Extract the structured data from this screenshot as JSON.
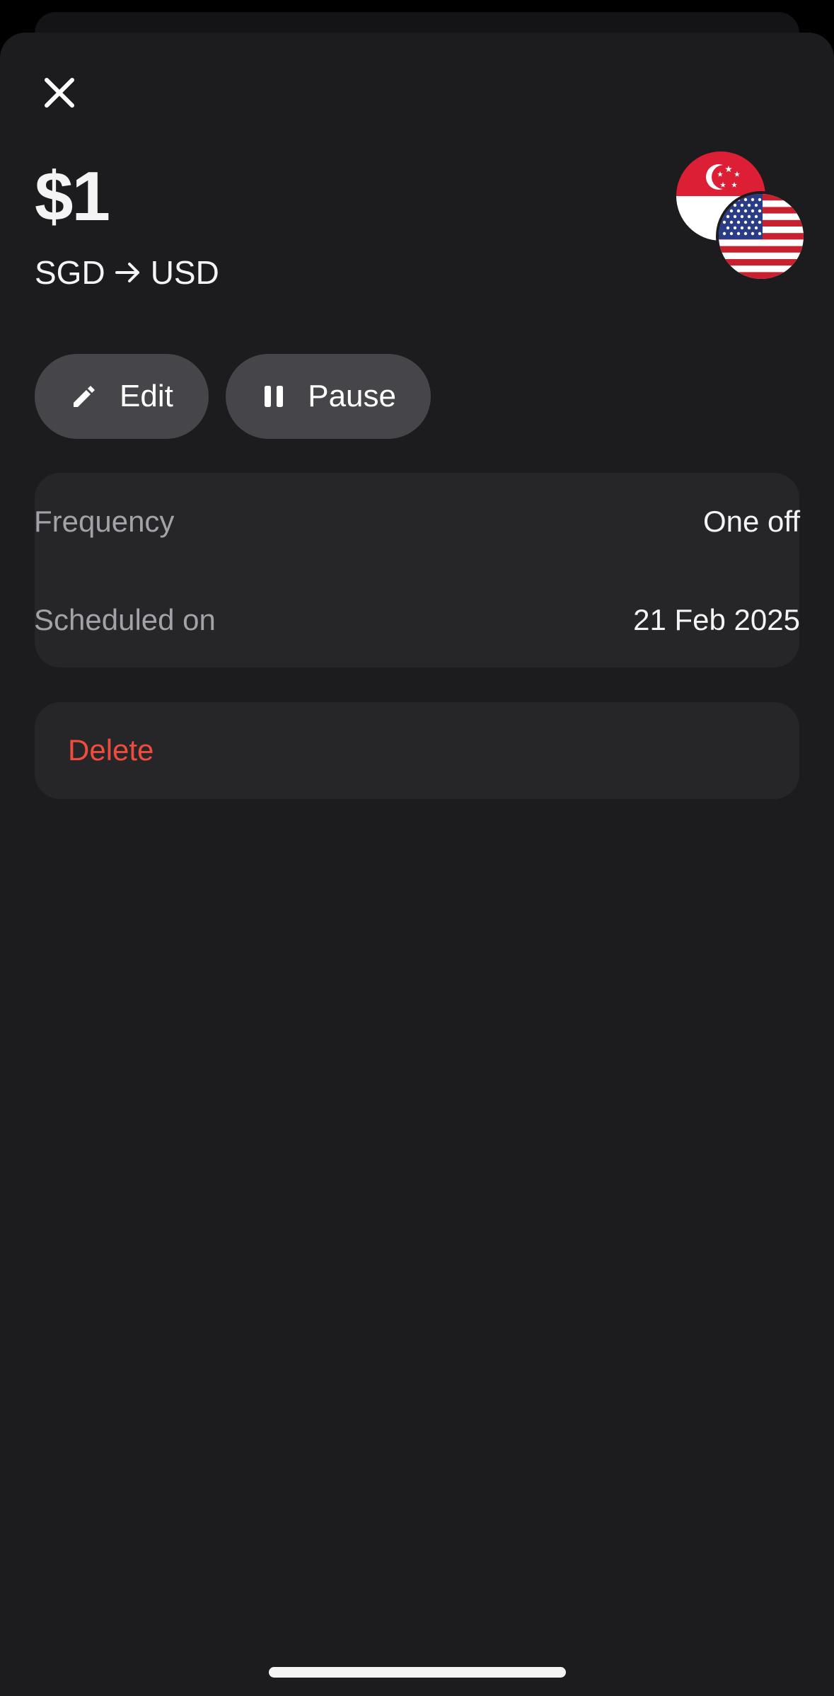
{
  "header": {
    "amount": "$1",
    "pair_from": "SGD",
    "pair_to": "USD"
  },
  "icons": {
    "close": "close-icon",
    "arrow": "arrow-right-icon",
    "edit": "pencil-icon",
    "pause": "pause-icon",
    "flag_from": "singapore-flag-icon",
    "flag_to": "usa-flag-icon"
  },
  "actions": {
    "edit_label": "Edit",
    "pause_label": "Pause"
  },
  "details": {
    "frequency_label": "Frequency",
    "frequency_value": "One off",
    "scheduled_label": "Scheduled on",
    "scheduled_value": "21 Feb 2025"
  },
  "danger": {
    "delete_label": "Delete"
  },
  "colors": {
    "background": "#1c1c1f",
    "card": "#262629",
    "pill": "#46464a",
    "danger": "#ef4c3e",
    "muted_text": "#a2a2a8"
  }
}
